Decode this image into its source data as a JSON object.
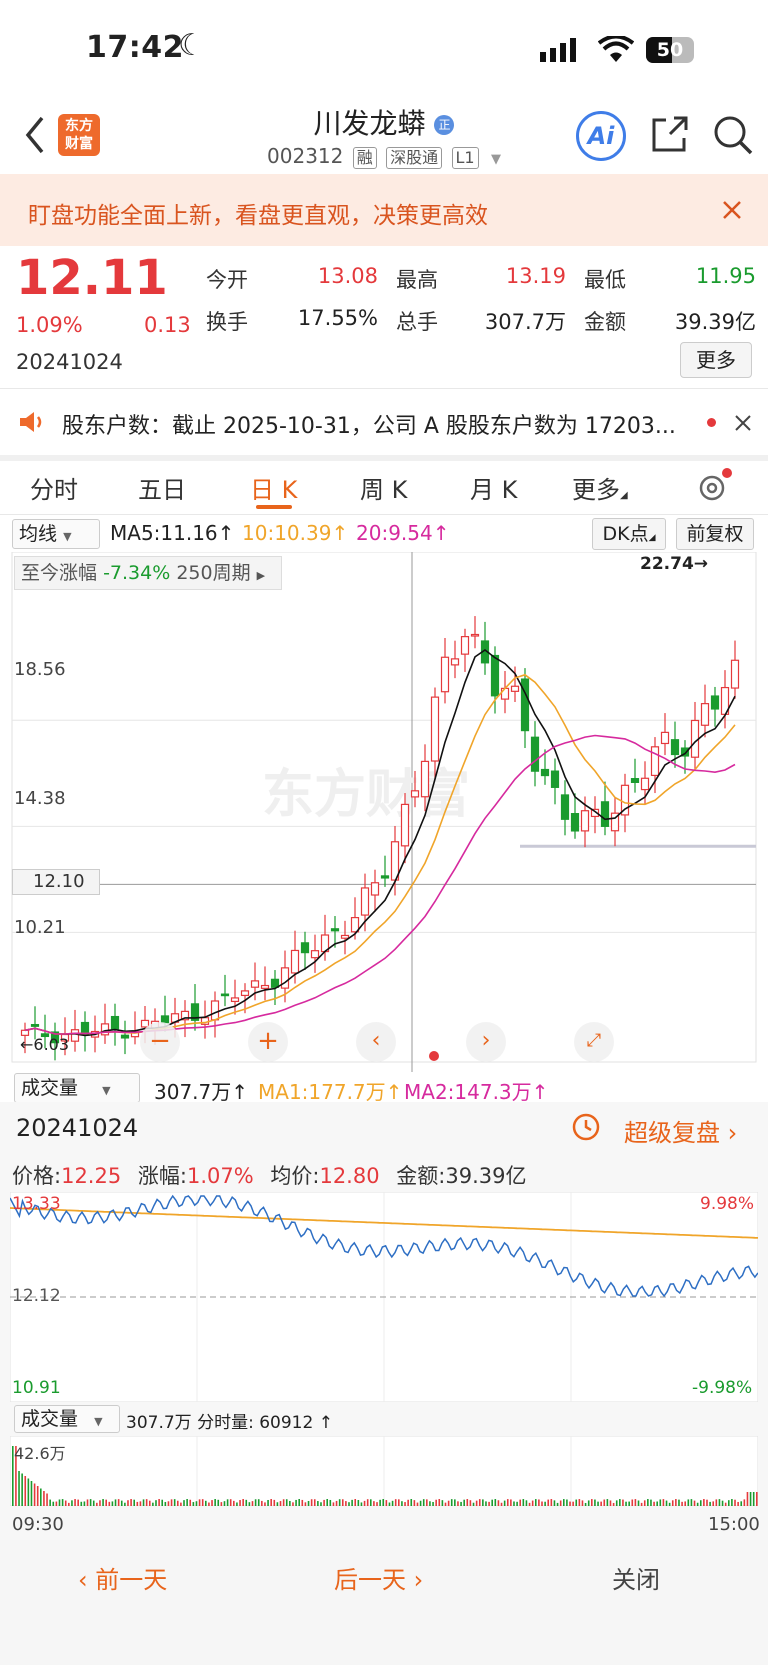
{
  "status_bar": {
    "time": "17:42",
    "battery": "50"
  },
  "header": {
    "title": "川发龙蟒",
    "code": "002312",
    "tags": [
      "融",
      "深股通",
      "L1"
    ],
    "logo_text": "东方\n财富"
  },
  "banner": {
    "text": "盯盘功能全面上新，看盘更直观，决策更高效"
  },
  "quote": {
    "price": "12.11",
    "change_pct": "1.09%",
    "change": "0.13",
    "date": "20241024",
    "more": "更多",
    "fields": [
      {
        "label": "今开",
        "value": "13.08",
        "color": "red"
      },
      {
        "label": "最高",
        "value": "13.19",
        "color": "red"
      },
      {
        "label": "最低",
        "value": "11.95",
        "color": "green"
      },
      {
        "label": "换手",
        "value": "17.55%",
        "color": "normal"
      },
      {
        "label": "总手",
        "value": "307.7万",
        "color": "normal"
      },
      {
        "label": "金额",
        "value": "39.39亿",
        "color": "normal"
      }
    ]
  },
  "notice": {
    "text": "股东户数：截止 2025-10-31，公司 A 股股东户数为 17203..."
  },
  "tabs": [
    "分时",
    "五日",
    "日 K",
    "周 K",
    "月 K",
    "更多"
  ],
  "active_tab": "日 K",
  "kline": {
    "indicator_select": "均线",
    "ma5": "MA5:11.16",
    "ma10": "10:10.39",
    "ma20": "20:9.54",
    "dk_button": "DK点",
    "fuquan_button": "前复权",
    "range_label": "至今涨幅",
    "range_value": "-7.34%",
    "range_period": "250周期",
    "y_labels": [
      "18.56",
      "14.38",
      "12.10",
      "10.21"
    ],
    "high_marker": "22.74→",
    "low_marker": "←6.03",
    "watermark": "东方财富"
  },
  "volume_row": {
    "select": "成交量",
    "value": "307.7万",
    "ma1": "MA1:177.7万",
    "ma2": "MA2:147.3万"
  },
  "detail": {
    "date": "20241024",
    "fupan": "超级复盘",
    "price_label": "价格:",
    "price_value": "12.25",
    "chg_label": "涨幅:",
    "chg_value": "1.07%",
    "avg_label": "均价:",
    "avg_value": "12.80",
    "amt_label": "金额:",
    "amt_value": "39.39亿"
  },
  "intraday": {
    "top_price": "13.33",
    "top_pct": "9.98%",
    "mid_price": "12.12",
    "bottom_price": "10.91",
    "bottom_pct": "-9.98%",
    "vol_select": "成交量",
    "vol_text": "307.7万 分时量: 60912",
    "vol_max": "42.6万",
    "time_start": "09:30",
    "time_end": "15:00"
  },
  "bottom": {
    "prev": "前一天",
    "next": "后一天",
    "close": "关闭"
  },
  "colors": {
    "up": "#e4393c",
    "down": "#1a9b2e",
    "accent": "#e8641b",
    "ma10": "#f0a52a",
    "ma20": "#d62a9e"
  }
}
